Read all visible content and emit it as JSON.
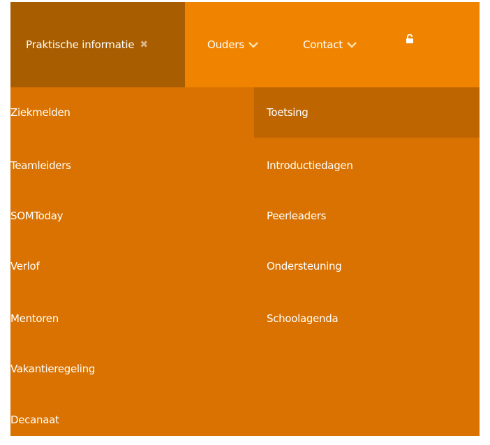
{
  "nav": {
    "items": [
      {
        "label": "Praktische informatie",
        "state": "open",
        "icon": "close-icon"
      },
      {
        "label": "Ouders",
        "icon": "chevron-down-icon"
      },
      {
        "label": "Contact",
        "icon": "chevron-down-icon"
      }
    ],
    "lock_icon": "unlock-icon"
  },
  "dropdown": {
    "left_items": [
      "Ziekmelden",
      "Teamleiders",
      "SOMToday",
      "Verlof",
      "Mentoren",
      "Vakantieregeling",
      "Decanaat"
    ],
    "right_items": [
      "Toetsing",
      "Introductiedagen",
      "Peerleaders",
      "Ondersteuning",
      "Schoolagenda"
    ],
    "active_item": "Toetsing"
  },
  "colors": {
    "nav_bg": "#f08400",
    "nav_active_bg": "#a85e00",
    "panel_bg": "#d97200",
    "item_active_bg": "#bf6500",
    "text": "#ffffff"
  }
}
